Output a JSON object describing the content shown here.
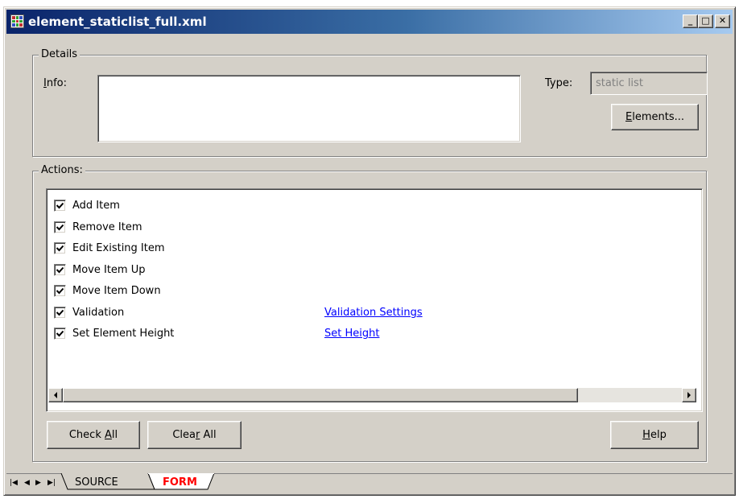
{
  "window": {
    "title": "element_staticlist_full.xml",
    "minimize_glyph": "_",
    "maximize_glyph": "□",
    "close_glyph": "✕"
  },
  "details": {
    "legend": "Details",
    "info_label_key": "I",
    "info_label_rest": "nfo:",
    "info_value": "",
    "type_label": "Type:",
    "type_value": "static list",
    "elements_button_key": "E",
    "elements_button_rest": "lements..."
  },
  "actions": {
    "legend": "Actions:",
    "items": [
      {
        "label": "Add Item",
        "checked": true,
        "link": ""
      },
      {
        "label": "Remove Item",
        "checked": true,
        "link": ""
      },
      {
        "label": "Edit Existing Item",
        "checked": true,
        "link": ""
      },
      {
        "label": "Move Item Up",
        "checked": true,
        "link": ""
      },
      {
        "label": "Move Item Down",
        "checked": true,
        "link": ""
      },
      {
        "label": "Validation",
        "checked": true,
        "link": "Validation Settings"
      },
      {
        "label": "Set Element Height",
        "checked": true,
        "link": "Set Height"
      }
    ],
    "check_all_pre": "Check ",
    "check_all_key": "A",
    "check_all_post": "ll",
    "clear_all_pre": "Clea",
    "clear_all_key": "r",
    "clear_all_post": " All",
    "help_key": "H",
    "help_rest": "elp"
  },
  "tabs": {
    "items": [
      "SOURCE",
      "FORM"
    ],
    "active": "FORM",
    "active_color": "#ff0000"
  }
}
